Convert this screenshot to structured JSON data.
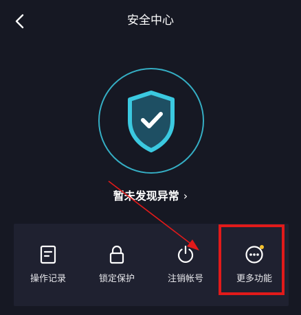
{
  "header": {
    "title": "安全中心",
    "back_icon": "chevron-left-icon"
  },
  "security": {
    "status_text": "暂未发现异常",
    "status_chevron": "›",
    "shield_icon": "shield-check-icon",
    "accent_color": "#3bc9e0"
  },
  "functions": [
    {
      "label": "操作记录",
      "icon": "document-icon"
    },
    {
      "label": "锁定保护",
      "icon": "lock-icon"
    },
    {
      "label": "注销帐号",
      "icon": "power-icon"
    },
    {
      "label": "更多功能",
      "icon": "more-circle-icon",
      "badge_color": "#f5c12e"
    }
  ],
  "annotation": {
    "highlight_color": "#e11a1a"
  }
}
